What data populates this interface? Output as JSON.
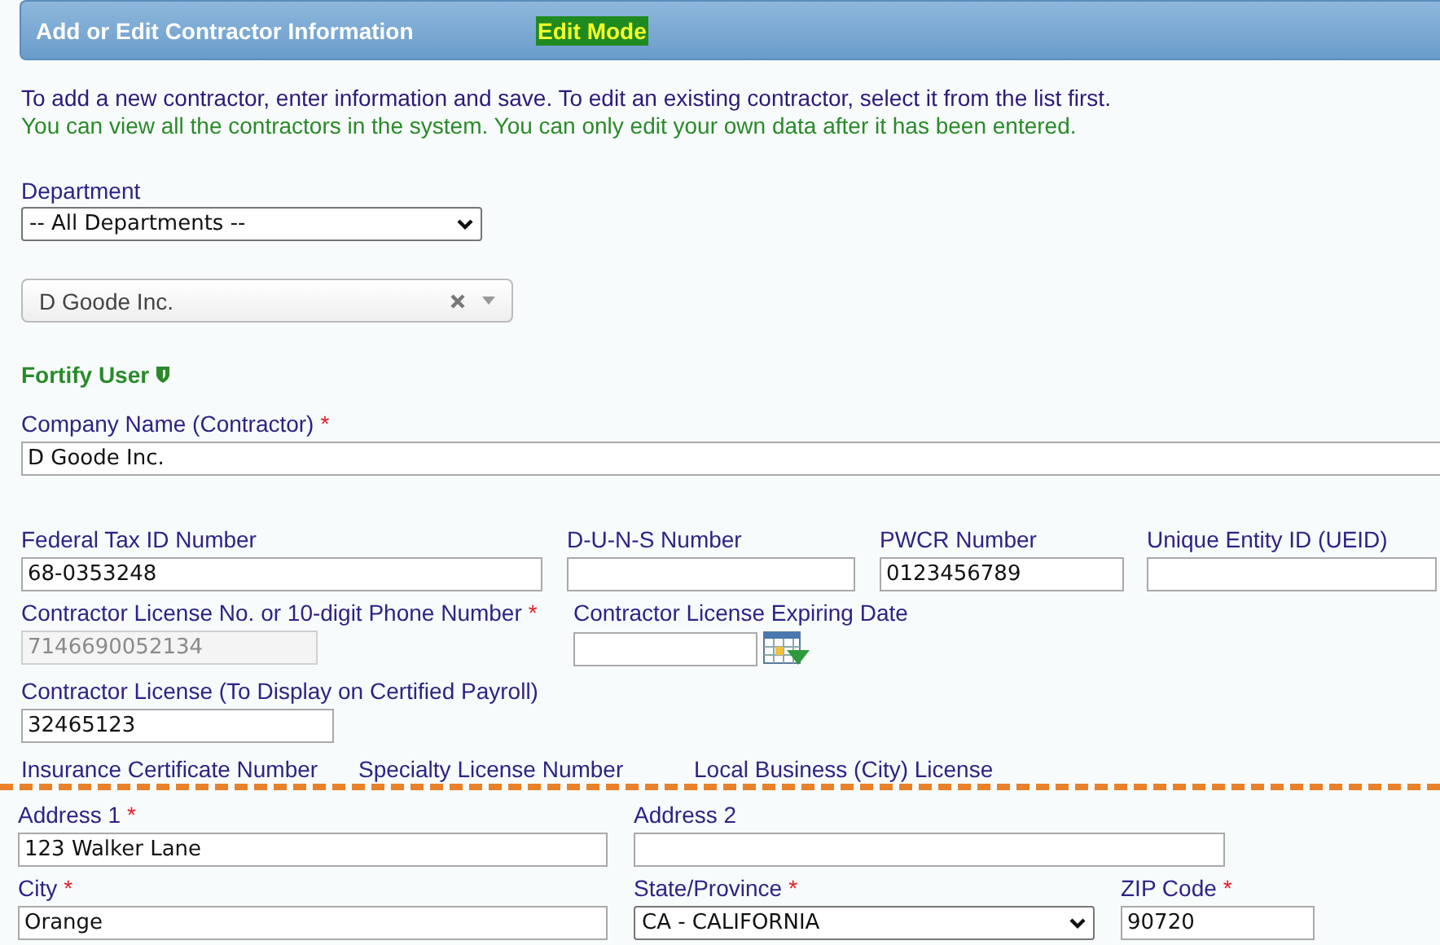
{
  "header": {
    "title": "Add or Edit Contractor Information",
    "mode_badge": "Edit Mode"
  },
  "instructions": [
    {
      "kind": "info",
      "text": "To add a new contractor, enter information and save. To edit an existing contractor, select it from the list first."
    },
    {
      "kind": "note",
      "text": "You can view all the contractors in the system. You can only edit your own data after it has been entered."
    }
  ],
  "department": {
    "label": "Department",
    "value": "-- All Departments --"
  },
  "contractor_picker": {
    "value": "D Goode Inc."
  },
  "fortify_user": {
    "label": "Fortify User"
  },
  "company": {
    "label": "Company Name (Contractor)",
    "required_mark": "*",
    "value": "D Goode Inc."
  },
  "field_rows": [
    [
      {
        "kind": "text",
        "label": "Federal Tax ID Number",
        "value": "68-0353248"
      },
      {
        "kind": "text",
        "label": "D-U-N-S Number"
      },
      {
        "kind": "text",
        "label": "PWCR Number",
        "value": "0123456789"
      },
      {
        "kind": "text",
        "label": "Unique Entity ID (UEID)"
      }
    ],
    [
      {
        "kind": "text",
        "label": "Contractor License No. or 10-digit Phone Number",
        "required_mark": "*",
        "value": "7146690052134",
        "disabled": true
      },
      {
        "kind": "date",
        "label": "Contractor License Expiring Date"
      }
    ],
    [
      {
        "kind": "text",
        "label": "Contractor License (To Display on Certified Payroll)",
        "value": "32465123"
      }
    ]
  ],
  "cut_labels": [
    "Insurance Certificate Number",
    "Specialty License Number",
    "Local Business (City) License"
  ],
  "address_rows": [
    [
      {
        "kind": "text",
        "label": "Address 1",
        "required_mark": "*",
        "value": "123 Walker Lane"
      },
      {
        "kind": "text",
        "label": "Address 2"
      }
    ],
    [
      {
        "kind": "text",
        "label": "City",
        "required_mark": "*",
        "value": "Orange"
      },
      {
        "kind": "select",
        "label": "State/Province",
        "required_mark": "*",
        "value": "CA - CALIFORNIA"
      },
      {
        "kind": "text",
        "label": "ZIP Code",
        "required_mark": "*",
        "value": "90720"
      }
    ]
  ]
}
